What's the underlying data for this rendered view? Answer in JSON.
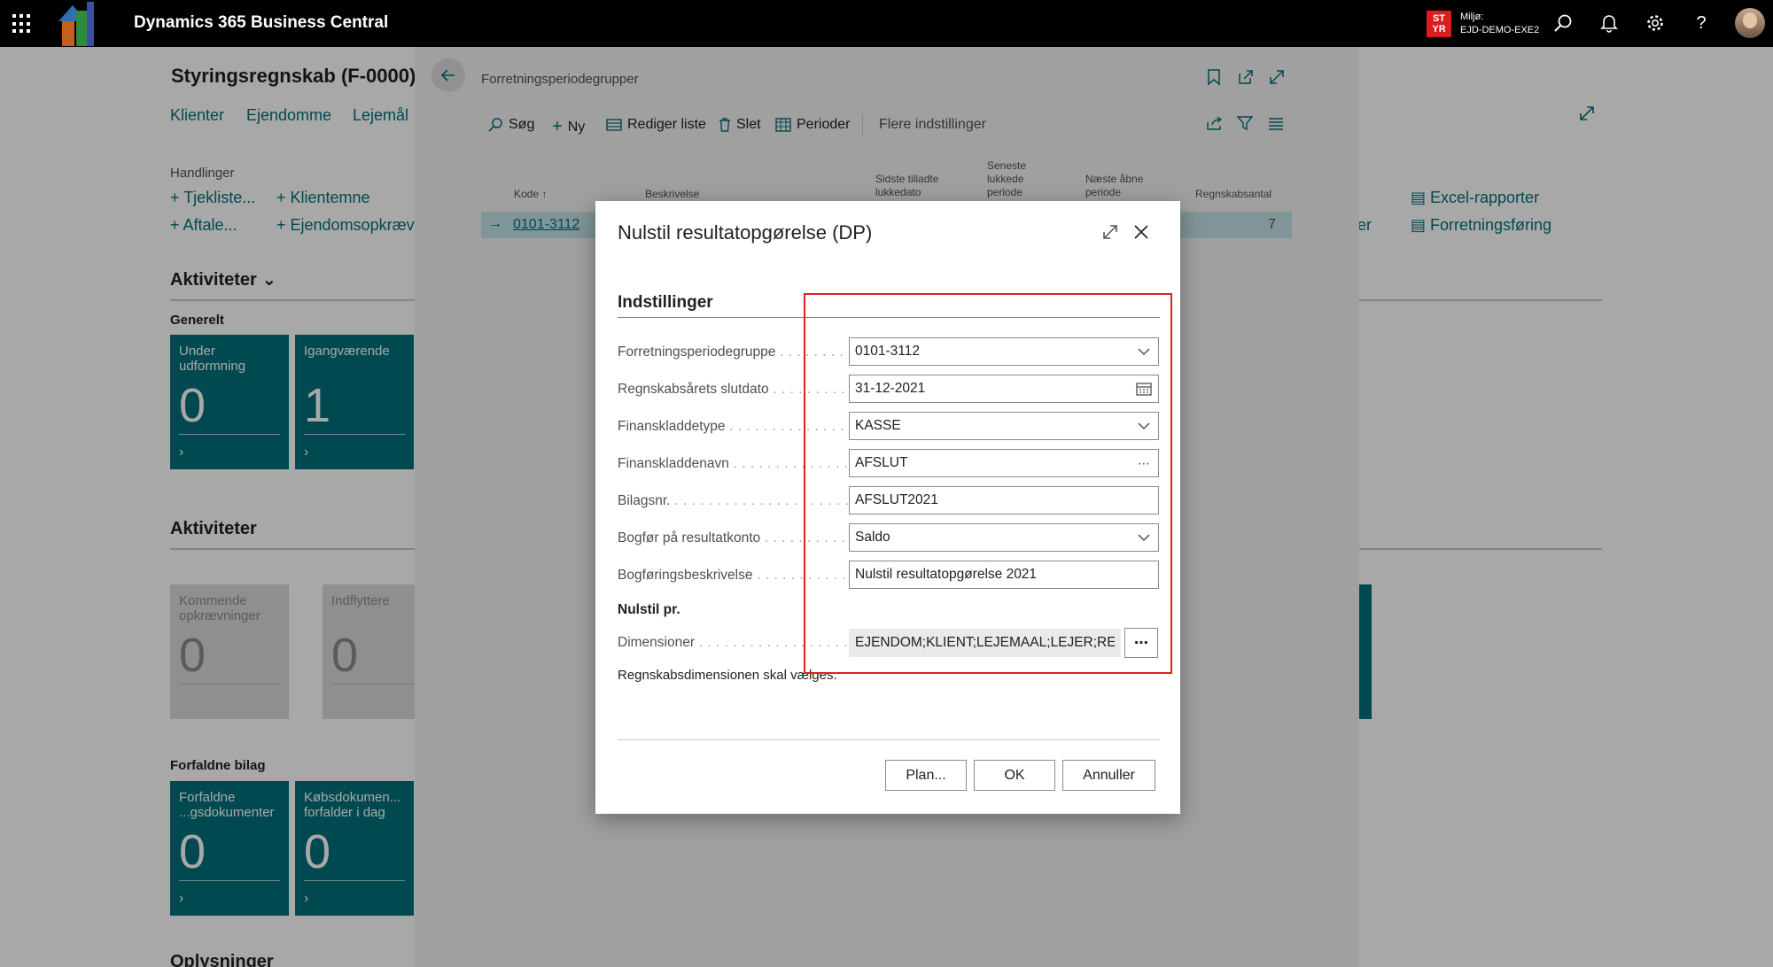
{
  "topbar": {
    "app_title": "Dynamics 365 Business Central",
    "env_badge": "ST\nYR",
    "env_label": "Miljø:",
    "env_name": "EJD-DEMO-EXE2",
    "icons": [
      "waffle-icon",
      "search-icon",
      "bell-icon",
      "gear-icon",
      "help-icon",
      "avatar"
    ]
  },
  "rolecenter": {
    "title": "Styringsregnskab (F-0000)",
    "nav": [
      "Klienter",
      "Ejendomme",
      "Lejemål"
    ],
    "actions_heading": "Handlinger",
    "actions": [
      "Tjekliste...",
      "Klientemne",
      "Aftale...",
      "Ejendomsopkræv"
    ],
    "actions_right": [
      "Excel-rapporter",
      "Forretningsføring"
    ],
    "activities1_heading": "Aktiviteter",
    "general_heading": "Generelt",
    "cues1": [
      {
        "label": "Under udformning",
        "value": "0"
      },
      {
        "label": "Igangværende",
        "value": "1"
      }
    ],
    "activities2_heading": "Aktiviteter",
    "cues2": [
      {
        "label": "Kommende opkrævninger",
        "value": "0"
      },
      {
        "label": "Indflyttere",
        "value": "0"
      }
    ],
    "overdue_heading": "Forfaldne bilag",
    "cues3": [
      {
        "label": "Forfaldne ...gsdokumenter",
        "value": "0"
      },
      {
        "label": "Købsdokumen... forfalder i dag",
        "value": "0"
      }
    ],
    "info_heading": "Oplysninger",
    "partial_text": "er"
  },
  "listpage": {
    "title": "Forretningsperiodegrupper",
    "toolbar": [
      "Søg",
      "Ny",
      "Rediger liste",
      "Slet",
      "Perioder",
      "Flere indstillinger"
    ],
    "columns": [
      "Kode",
      "Beskrivelse",
      "Sidste tilladte lukkedato",
      "Seneste lukkede periode",
      "Næste åbne periode",
      "Regnskabsantal"
    ],
    "row": {
      "code": "0101-3112",
      "count": "7"
    }
  },
  "dialog": {
    "title": "Nulstil resultatopgørelse (DP)",
    "group": "Indstillinger",
    "fields": [
      {
        "label": "Forretningsperiodegruppe",
        "value": "0101-3112",
        "suffix": "chevron-down-icon"
      },
      {
        "label": "Regnskabsårets slutdato",
        "value": "31-12-2021",
        "suffix": "calendar-icon"
      },
      {
        "label": "Finanskladdetype",
        "value": "KASSE",
        "suffix": "chevron-down-icon"
      },
      {
        "label": "Finanskladdenavn",
        "value": "AFSLUT",
        "suffix": "ellipsis-icon"
      },
      {
        "label": "Bilagsnr.",
        "value": "AFSLUT2021",
        "suffix": ""
      },
      {
        "label": "Bogfør på resultatkonto",
        "value": "Saldo",
        "suffix": "chevron-down-icon"
      },
      {
        "label": "Bogføringsbeskrivelse",
        "value": "Nulstil resultatopgørelse 2021",
        "suffix": ""
      }
    ],
    "subgroup": "Nulstil pr.",
    "dimensions_label": "Dimensioner",
    "dimensions_value": "EJENDOM;KLIENT;LEJEMAAL;LEJER;REGNS...",
    "dimensions_button": "⋯",
    "info_text": "Regnskabsdimensionen skal vælges.",
    "buttons": {
      "plan": "Plan...",
      "ok": "OK",
      "cancel": "Annuller"
    }
  },
  "colors": {
    "accent": "#00707a",
    "highlight": "#e02020",
    "topbar": "#000000"
  }
}
